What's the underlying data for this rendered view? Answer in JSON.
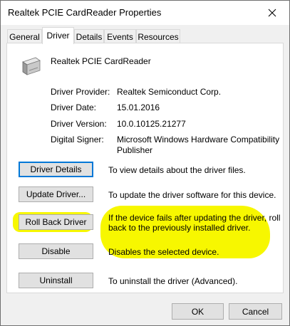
{
  "window": {
    "title": "Realtek PCIE CardReader Properties"
  },
  "tabs": [
    {
      "label": "General"
    },
    {
      "label": "Driver"
    },
    {
      "label": "Details"
    },
    {
      "label": "Events"
    },
    {
      "label": "Resources"
    }
  ],
  "active_tab": "Driver",
  "device": {
    "name": "Realtek PCIE CardReader",
    "icon": "card-reader-icon"
  },
  "properties": {
    "provider_label": "Driver Provider:",
    "provider_value": "Realtek Semiconduct Corp.",
    "date_label": "Driver Date:",
    "date_value": "15.01.2016",
    "version_label": "Driver Version:",
    "version_value": "10.0.10125.21277",
    "signer_label": "Digital Signer:",
    "signer_value_line1": "Microsoft Windows Hardware Compatibility",
    "signer_value_line2": "Publisher"
  },
  "actions": {
    "details_label": "Driver Details",
    "details_desc": "To view details about the driver files.",
    "update_label": "Update Driver...",
    "update_desc": "To update the driver software for this device.",
    "rollback_label": "Roll Back Driver",
    "rollback_desc_line1": "If the device fails after updating the driver, roll",
    "rollback_desc_line2": "back to the previously installed driver.",
    "disable_label": "Disable",
    "disable_desc": "Disables the selected device.",
    "uninstall_label": "Uninstall",
    "uninstall_desc": "To uninstall the driver (Advanced)."
  },
  "footer": {
    "ok_label": "OK",
    "cancel_label": "Cancel"
  },
  "colors": {
    "highlight": "#f7f700",
    "focus": "#0078d7"
  }
}
